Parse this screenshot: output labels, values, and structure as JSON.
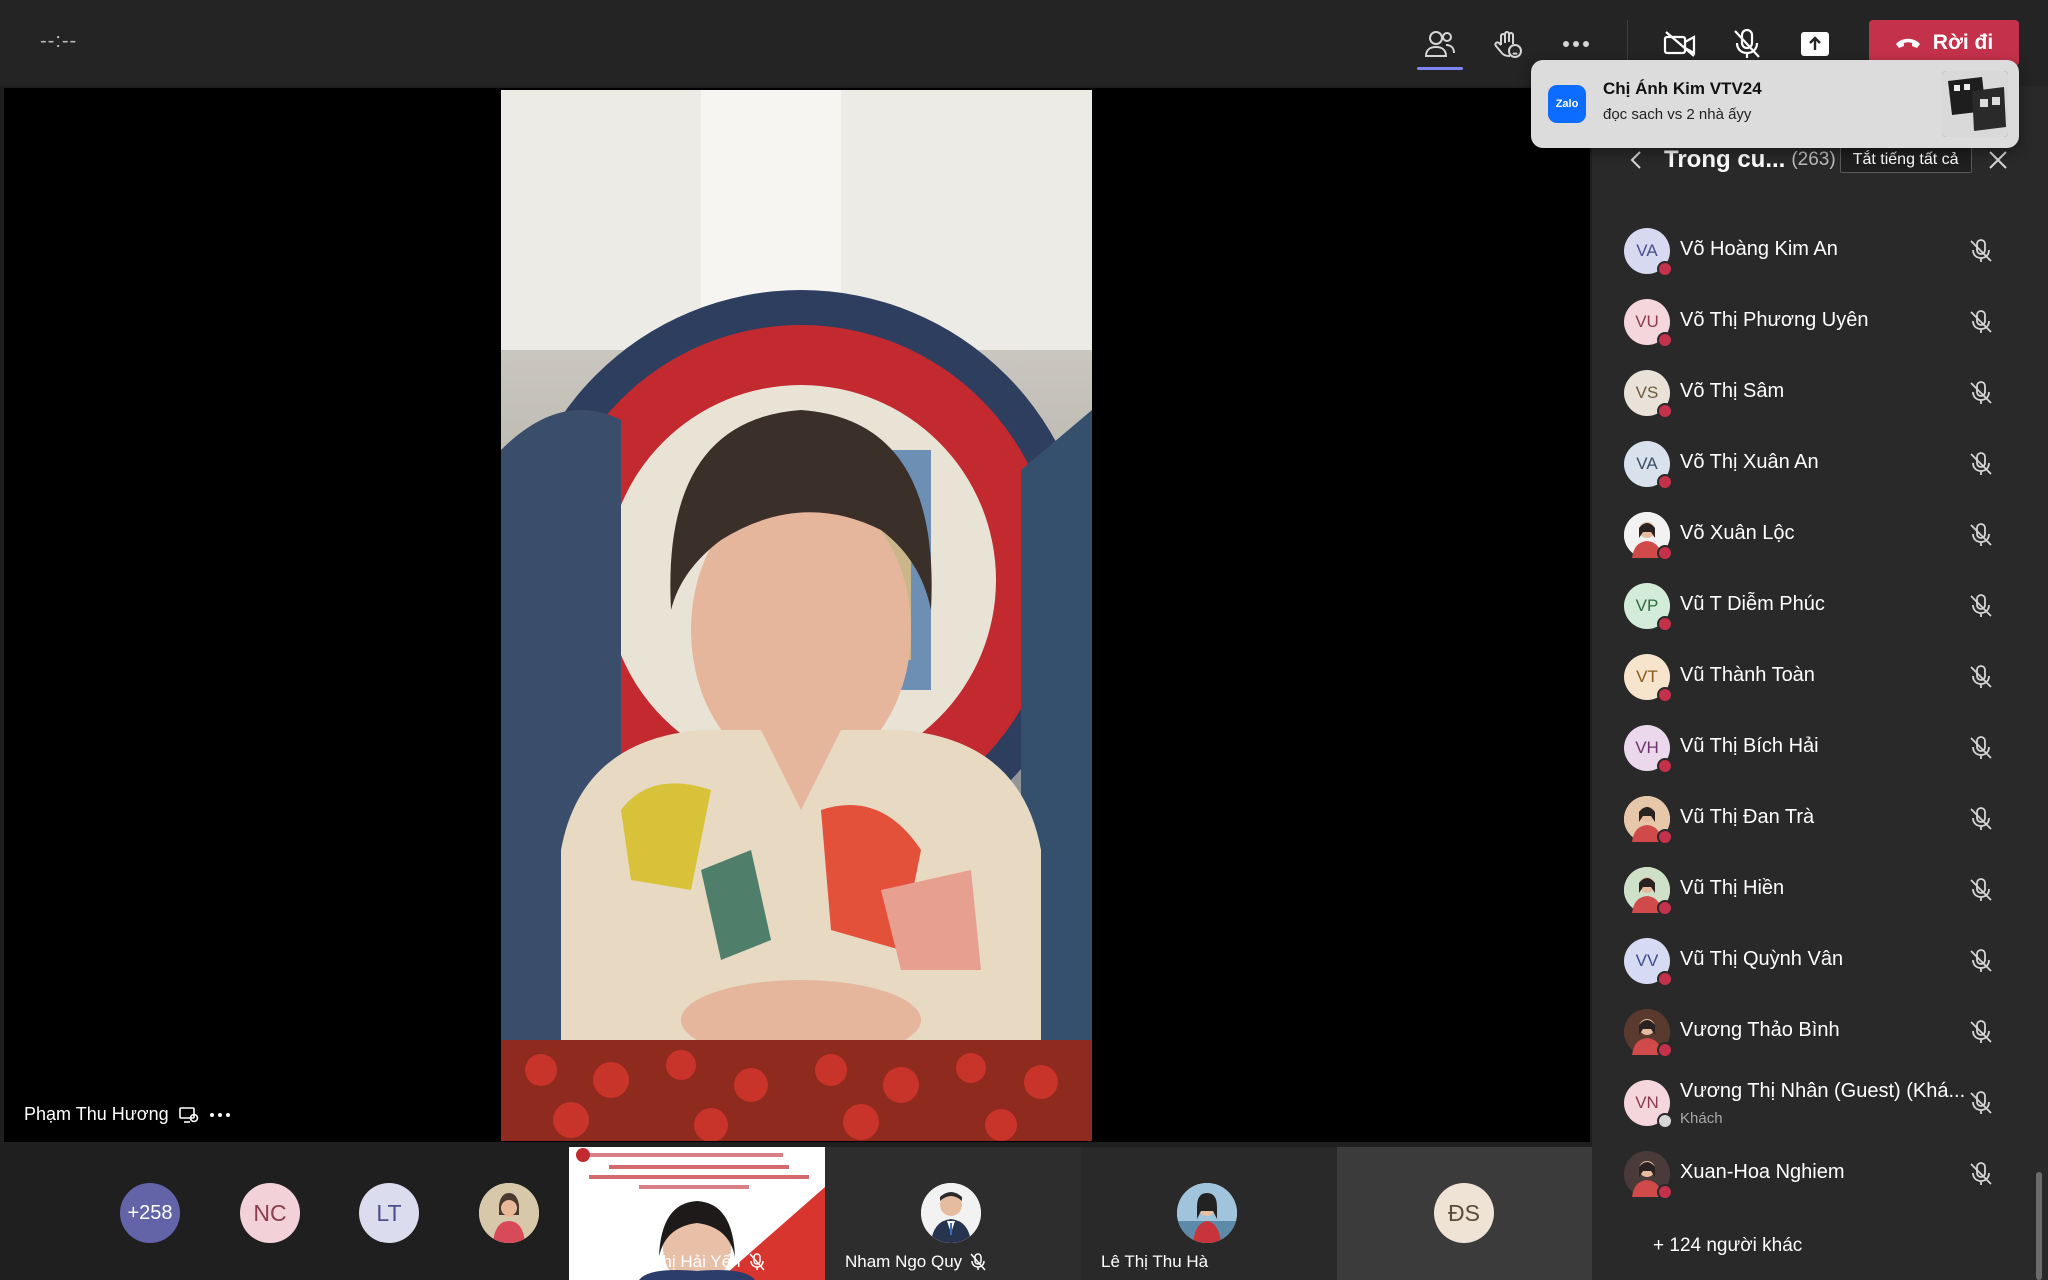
{
  "topbar": {
    "timer": "--:--",
    "leave_label": "Rời đi",
    "icons": [
      "people-icon",
      "raise-hand-icon",
      "more-icon",
      "camera-off-icon",
      "mic-off-icon",
      "share-icon"
    ]
  },
  "toast": {
    "app_name": "Zalo",
    "title": "Chị Ánh Kim VTV24",
    "message": "đọc  sach  vs 2 nhà  ấyy"
  },
  "stage": {
    "speaker_name": "Phạm Thu Hương",
    "video_description": "speaker-video-feed"
  },
  "strip": {
    "overflow_count": "+258",
    "avatars": [
      "NC",
      "LT"
    ],
    "tiles": [
      {
        "name": "Nguyễn Thị Hải Yến",
        "muted": true
      },
      {
        "name": "Nham Ngo Quy",
        "muted": true
      },
      {
        "name": "Lê Thị Thu Hà",
        "muted": false
      },
      {
        "initials": "ĐS"
      }
    ]
  },
  "panel": {
    "title": "Trong cu...",
    "count": "(263)",
    "mute_all_label": "Tắt tiếng tất cả",
    "participants": [
      {
        "initials": "VA",
        "name": "Võ Hoàng Kim An",
        "color": "#d6d9f0",
        "text": "#4b4f8c"
      },
      {
        "initials": "VU",
        "name": "Võ Thị Phương Uyên",
        "color": "#f4d6dc",
        "text": "#8c3d4e"
      },
      {
        "initials": "VS",
        "name": "Võ Thị Sâm",
        "color": "#e8e2d8",
        "text": "#6b5a3e"
      },
      {
        "initials": "VA",
        "name": "Võ Thị Xuân An",
        "color": "#d9e2ec",
        "text": "#3d4f66"
      },
      {
        "initials": "",
        "name": "Võ Xuân Lộc",
        "color": "#f2f2f2",
        "text": "#333333",
        "photo": true
      },
      {
        "initials": "VP",
        "name": "Vũ T Diễm Phúc",
        "color": "#d3ecd9",
        "text": "#2f6b3f"
      },
      {
        "initials": "VT",
        "name": "Vũ Thành Toàn",
        "color": "#f6e4cc",
        "text": "#8a5a1c"
      },
      {
        "initials": "VH",
        "name": "Vũ Thị Bích Hải",
        "color": "#ecd8ec",
        "text": "#6b336b"
      },
      {
        "initials": "",
        "name": "Vũ Thị Đan Trà",
        "color": "#e6c7a9",
        "text": "#333333",
        "photo": true
      },
      {
        "initials": "",
        "name": "Vũ Thị Hiền",
        "color": "#cfe0c8",
        "text": "#333333",
        "photo": true
      },
      {
        "initials": "VV",
        "name": "Vũ Thị Quỳnh Vân",
        "color": "#d6dbf3",
        "text": "#3e4a8c"
      },
      {
        "initials": "",
        "name": "Vương Thảo Bình",
        "color": "#5a3a2e",
        "text": "#ffffff",
        "photo": true
      },
      {
        "initials": "VN",
        "name": "Vương Thị Nhân (Guest) (Khá...",
        "sub": "Khách",
        "color": "#f4d6dc",
        "text": "#8c3d4e",
        "guest": true
      },
      {
        "initials": "",
        "name": "Xuan-Hoa Nghiem",
        "color": "#4a3a3a",
        "text": "#ffffff",
        "photo": true
      }
    ],
    "more_people": "+ 124 người khác"
  }
}
